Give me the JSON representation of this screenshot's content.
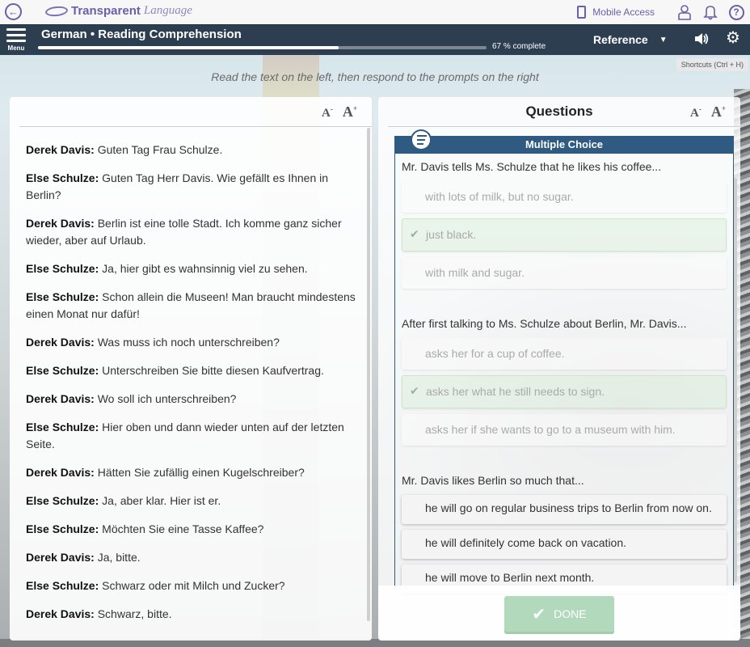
{
  "topbar": {
    "brand": "Transparent",
    "brand_suffix": "Language",
    "mobile_access": "Mobile Access",
    "icons": [
      "back-arrow-icon",
      "mobile-phone-icon",
      "user-profile-icon",
      "bell-icon",
      "help-icon"
    ],
    "help_glyph": "?"
  },
  "navbar": {
    "menu_label": "Menu",
    "course_title": "German • Reading Comprehension",
    "progress_percent": 67,
    "progress_text": "67 % complete",
    "reference_label": "Reference",
    "caret": "▼",
    "speaker_glyph": "🔊",
    "gear_glyph": "⚙"
  },
  "shortcuts_hint": "Shortcuts (Ctrl + H)",
  "instruction": "Read the text on the left, then respond to the prompts on the right",
  "font_controls": {
    "decrease": "A",
    "decrease_sup": "-",
    "increase": "A",
    "increase_sup": "+"
  },
  "dialogue": [
    {
      "speaker": "Derek Davis:",
      "text": "Guten Tag Frau Schulze."
    },
    {
      "speaker": "Else Schulze:",
      "text": "Guten Tag Herr Davis. Wie gefällt es Ihnen in Berlin?"
    },
    {
      "speaker": "Derek Davis:",
      "text": "Berlin ist eine tolle Stadt. Ich komme ganz sicher wieder, aber auf Urlaub."
    },
    {
      "speaker": "Else Schulze:",
      "text": "Ja, hier gibt es wahnsinnig viel zu sehen."
    },
    {
      "speaker": "Else Schulze:",
      "text": "Schon allein die Museen! Man braucht mindestens einen Monat nur dafür!"
    },
    {
      "speaker": "Derek Davis:",
      "text": "Was muss ich noch unterschreiben?"
    },
    {
      "speaker": "Else Schulze:",
      "text": "Unterschreiben Sie bitte diesen Kaufvertrag."
    },
    {
      "speaker": "Derek Davis:",
      "text": "Wo soll ich unterschreiben?"
    },
    {
      "speaker": "Else Schulze:",
      "text": "Hier oben und dann wieder unten auf der letzten Seite."
    },
    {
      "speaker": "Derek Davis:",
      "text": "Hätten Sie zufällig einen Kugelschreiber?"
    },
    {
      "speaker": "Else Schulze:",
      "text": "Ja, aber klar. Hier ist er."
    },
    {
      "speaker": "Else Schulze:",
      "text": "Möchten Sie eine Tasse Kaffee?"
    },
    {
      "speaker": "Derek Davis:",
      "text": "Ja, bitte."
    },
    {
      "speaker": "Else Schulze:",
      "text": "Schwarz oder mit Milch und Zucker?"
    },
    {
      "speaker": "Derek Davis:",
      "text": "Schwarz, bitte."
    }
  ],
  "questions_panel": {
    "title": "Questions",
    "section_label": "Multiple Choice",
    "check_glyph": "✔",
    "questions": [
      {
        "prompt": "Mr. Davis tells Ms. Schulze that he likes his coffee...",
        "options": [
          {
            "text": "with lots of milk, but no sugar.",
            "state": "answered"
          },
          {
            "text": "just black.",
            "state": "correct"
          },
          {
            "text": "with milk and sugar.",
            "state": "answered"
          }
        ]
      },
      {
        "prompt": "After first talking to Ms. Schulze about Berlin, Mr. Davis...",
        "options": [
          {
            "text": "asks her for a cup of coffee.",
            "state": "answered"
          },
          {
            "text": "asks her what he still needs to sign.",
            "state": "correct"
          },
          {
            "text": "asks her if she wants to go to a museum with him.",
            "state": "answered"
          }
        ]
      },
      {
        "prompt": "Mr. Davis likes Berlin so much that...",
        "options": [
          {
            "text": "he will go on regular business trips to Berlin from now on.",
            "state": "active"
          },
          {
            "text": "he will definitely come back on vacation.",
            "state": "active"
          },
          {
            "text": "he will move to Berlin next month.",
            "state": "active"
          }
        ]
      }
    ],
    "done_label": "DONE",
    "done_glyph": "✔"
  },
  "colors": {
    "brand_purple": "#6c5ea8",
    "navbar_bg": "#2c3e50",
    "mc_header": "#2f5a82",
    "done_green": "#b3d9bd"
  }
}
